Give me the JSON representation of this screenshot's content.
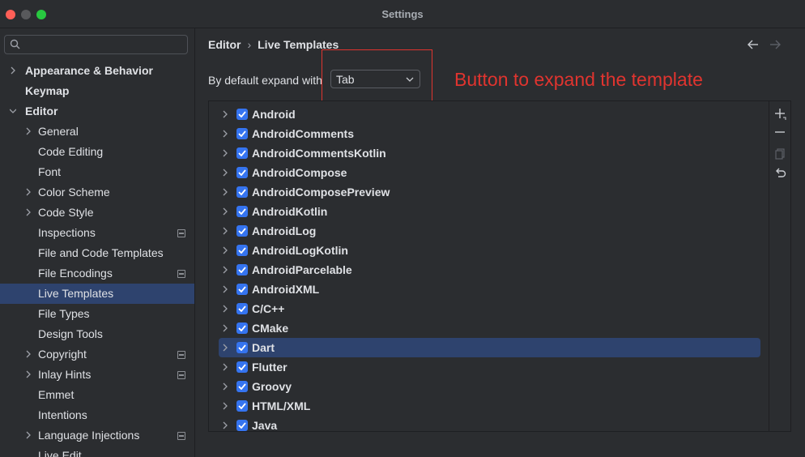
{
  "window": {
    "title": "Settings"
  },
  "search": {
    "placeholder": ""
  },
  "sidebar": {
    "items": [
      {
        "label": "Appearance & Behavior",
        "bold": true,
        "chevron": "right",
        "indent": 0,
        "badge": false
      },
      {
        "label": "Keymap",
        "bold": true,
        "chevron": "none",
        "indent": 0,
        "badge": false
      },
      {
        "label": "Editor",
        "bold": true,
        "chevron": "down",
        "indent": 0,
        "badge": false
      },
      {
        "label": "General",
        "bold": false,
        "chevron": "right",
        "indent": 1,
        "badge": false
      },
      {
        "label": "Code Editing",
        "bold": false,
        "chevron": "none",
        "indent": 1,
        "badge": false
      },
      {
        "label": "Font",
        "bold": false,
        "chevron": "none",
        "indent": 1,
        "badge": false
      },
      {
        "label": "Color Scheme",
        "bold": false,
        "chevron": "right",
        "indent": 1,
        "badge": false
      },
      {
        "label": "Code Style",
        "bold": false,
        "chevron": "right",
        "indent": 1,
        "badge": false
      },
      {
        "label": "Inspections",
        "bold": false,
        "chevron": "none",
        "indent": 1,
        "badge": true
      },
      {
        "label": "File and Code Templates",
        "bold": false,
        "chevron": "none",
        "indent": 1,
        "badge": false
      },
      {
        "label": "File Encodings",
        "bold": false,
        "chevron": "none",
        "indent": 1,
        "badge": true
      },
      {
        "label": "Live Templates",
        "bold": false,
        "chevron": "none",
        "indent": 1,
        "badge": false,
        "selected": true
      },
      {
        "label": "File Types",
        "bold": false,
        "chevron": "none",
        "indent": 1,
        "badge": false
      },
      {
        "label": "Design Tools",
        "bold": false,
        "chevron": "none",
        "indent": 1,
        "badge": false
      },
      {
        "label": "Copyright",
        "bold": false,
        "chevron": "right",
        "indent": 1,
        "badge": true
      },
      {
        "label": "Inlay Hints",
        "bold": false,
        "chevron": "right",
        "indent": 1,
        "badge": true
      },
      {
        "label": "Emmet",
        "bold": false,
        "chevron": "none",
        "indent": 1,
        "badge": false
      },
      {
        "label": "Intentions",
        "bold": false,
        "chevron": "none",
        "indent": 1,
        "badge": false
      },
      {
        "label": "Language Injections",
        "bold": false,
        "chevron": "right",
        "indent": 1,
        "badge": true
      },
      {
        "label": "Live Edit",
        "bold": false,
        "chevron": "none",
        "indent": 1,
        "badge": false
      }
    ]
  },
  "breadcrumb": {
    "parent": "Editor",
    "separator": "›",
    "current": "Live Templates"
  },
  "expand": {
    "label": "By default expand with",
    "value": "Tab"
  },
  "annotation": {
    "text": "Button to expand the template",
    "color": "#e0342f"
  },
  "templates": [
    {
      "label": "Android",
      "checked": true
    },
    {
      "label": "AndroidComments",
      "checked": true
    },
    {
      "label": "AndroidCommentsKotlin",
      "checked": true
    },
    {
      "label": "AndroidCompose",
      "checked": true
    },
    {
      "label": "AndroidComposePreview",
      "checked": true
    },
    {
      "label": "AndroidKotlin",
      "checked": true
    },
    {
      "label": "AndroidLog",
      "checked": true
    },
    {
      "label": "AndroidLogKotlin",
      "checked": true
    },
    {
      "label": "AndroidParcelable",
      "checked": true
    },
    {
      "label": "AndroidXML",
      "checked": true
    },
    {
      "label": "C/C++",
      "checked": true
    },
    {
      "label": "CMake",
      "checked": true
    },
    {
      "label": "Dart",
      "checked": true,
      "selected": true
    },
    {
      "label": "Flutter",
      "checked": true
    },
    {
      "label": "Groovy",
      "checked": true
    },
    {
      "label": "HTML/XML",
      "checked": true
    },
    {
      "label": "Java",
      "checked": true
    }
  ],
  "toolbar": [
    "add-icon",
    "remove-icon",
    "copy-icon",
    "restore-icon"
  ],
  "colors": {
    "accent": "#3574f0",
    "selection": "#2e436e",
    "background": "#2b2d30"
  }
}
